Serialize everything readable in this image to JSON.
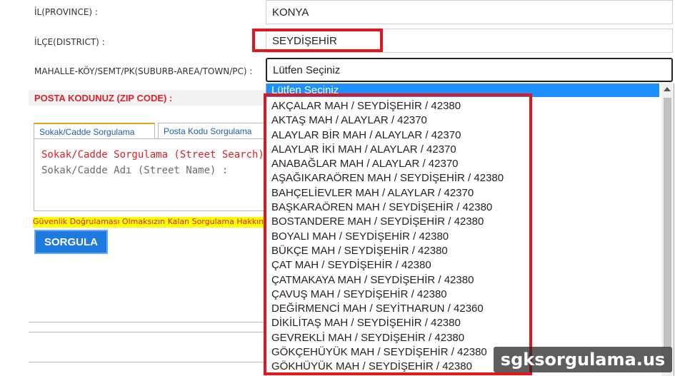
{
  "form": {
    "province_label": "İL(PROVINCE) :",
    "province_value": "KONYA",
    "district_label": "İLÇE(DISTRICT) :",
    "district_value": "SEYDİŞEHİR",
    "suburb_label": "MAHALLE-KÖY/SEMT/PK(SUBURB-AREA/TOWN/PC) :",
    "suburb_value": "Lütfen Seçiniz",
    "zip_label": "POSTA KODUNUZ (ZIP CODE) :"
  },
  "tabs": [
    {
      "label": "Sokak/Cadde Sorgulama"
    },
    {
      "label": "Posta Kodu Sorgulama"
    }
  ],
  "panel": {
    "title": "Sokak/Cadde Sorgulama (Street Search)",
    "street_label": "Sokak/Cadde Adı (Street Name) :"
  },
  "warning": "Güvenlik Doğrulaması Olmaksızın Kalan Sorgulama Hakkınız",
  "submit_label": "SORGULA",
  "dropdown": {
    "selected": "Lütfen Seçiniz",
    "options": [
      "AKÇALAR MAH / SEYDİŞEHİR / 42380",
      "AKTAŞ MAH / ALAYLAR / 42370",
      "ALAYLAR BİR MAH / ALAYLAR / 42370",
      "ALAYLAR İKİ MAH / ALAYLAR / 42370",
      "ANABAĞLAR MAH / ALAYLAR / 42370",
      "AŞAĞIKARAÖREN MAH / SEYDİŞEHİR / 42380",
      "BAHÇELİEVLER MAH / ALAYLAR / 42370",
      "BAŞKARAÖREN MAH / SEYDİŞEHİR / 42380",
      "BOSTANDERE MAH / SEYDİŞEHİR / 42380",
      "BOYALI MAH / SEYDİŞEHİR / 42380",
      "BÜKÇE MAH / SEYDİŞEHİR / 42380",
      "ÇAT MAH / SEYDİŞEHİR / 42380",
      "ÇATMAKAYA MAH / SEYDİŞEHİR / 42380",
      "ÇAVUŞ MAH / SEYDİŞEHİR / 42380",
      "DEĞİRMENCİ MAH / SEYİTHARUN / 42360",
      "DİKİLİTAŞ MAH / SEYDİŞEHİR / 42380",
      "GEVREKLİ MAH / SEYDİŞEHİR / 42380",
      "GÖKÇEHÜYÜK MAH / SEYDİŞEHİR / 42380",
      "GÖKHÜYÜK MAH / SEYDİŞEHİR / 42380"
    ]
  },
  "watermark": "sgksorgulama.us",
  "colors": {
    "highlight": "#e4161d",
    "accent": "#1e90ff",
    "error": "#e21f26"
  }
}
